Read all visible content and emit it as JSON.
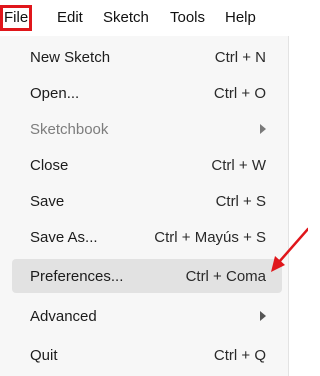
{
  "menubar": {
    "items": [
      {
        "label": "File",
        "active": true
      },
      {
        "label": "Edit"
      },
      {
        "label": "Sketch"
      },
      {
        "label": "Tools"
      },
      {
        "label": "Help"
      }
    ]
  },
  "file_menu": {
    "items": [
      {
        "label": "New Sketch",
        "shortcut": "Ctrl + N"
      },
      {
        "label": "Open...",
        "shortcut": "Ctrl + O"
      },
      {
        "label": "Sketchbook",
        "submenu": true,
        "disabled": true
      },
      {
        "label": "Close",
        "shortcut": "Ctrl + W"
      },
      {
        "label": "Save",
        "shortcut": "Ctrl + S"
      },
      {
        "label": "Save As...",
        "shortcut": "Ctrl + Mayús + S"
      },
      {
        "label": "Preferences...",
        "shortcut": "Ctrl + Coma",
        "highlighted": true
      },
      {
        "label": "Advanced",
        "submenu": true
      },
      {
        "label": "Quit",
        "shortcut": "Ctrl + Q"
      }
    ]
  },
  "annotation": {
    "color": "#e0161b",
    "icon": "red-arrow-icon"
  }
}
